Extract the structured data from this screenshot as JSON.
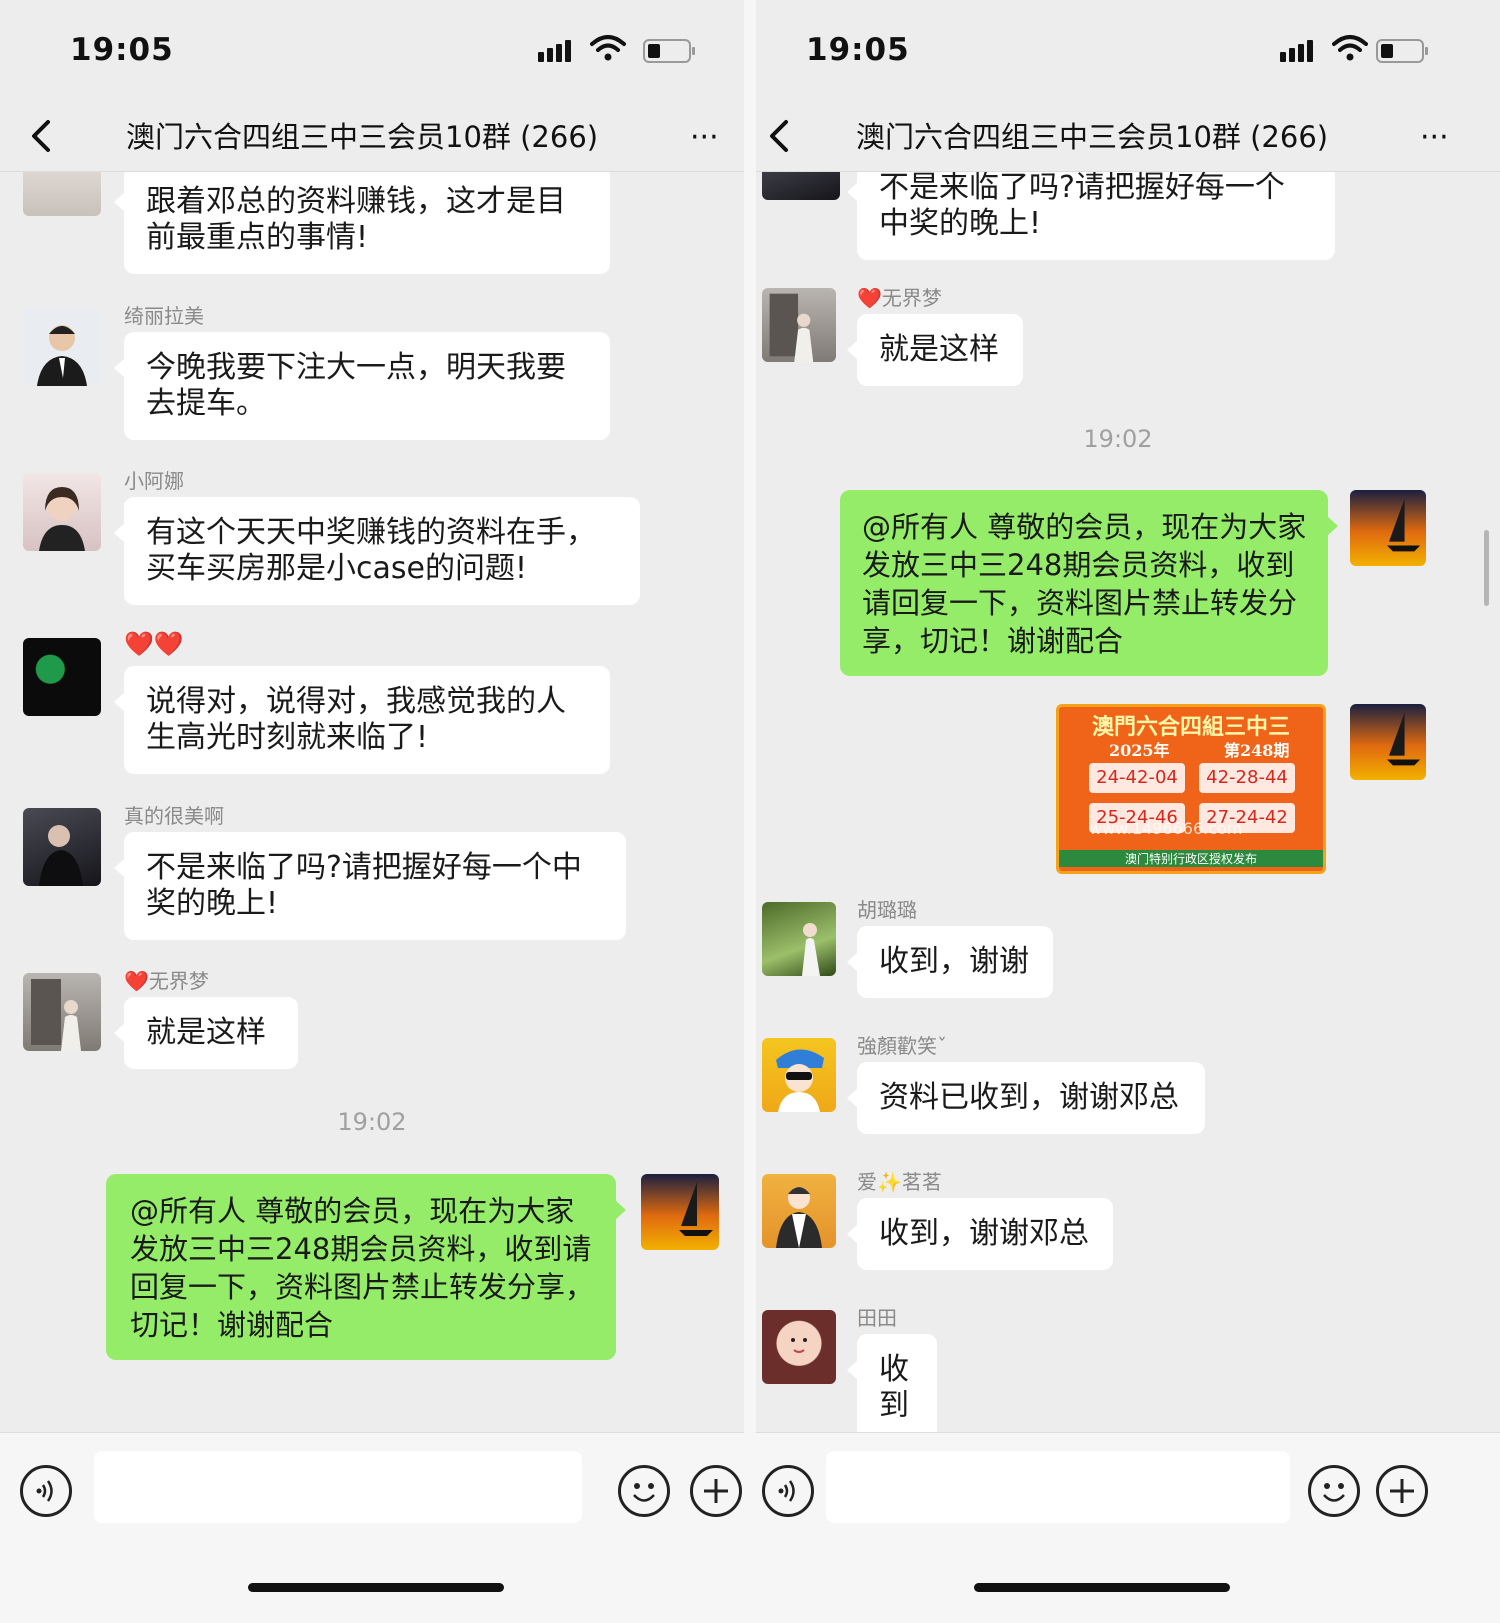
{
  "status": {
    "time": "19:05"
  },
  "header": {
    "title": "澳门六合四组三中三会员10群 (266)",
    "back_icon": "chevron-left-icon",
    "more_icon": "ellipsis-icon",
    "more_label": "···"
  },
  "left": {
    "messages": [
      {
        "sender": "",
        "text": "跟着邓总的资料赚钱，这才是目前最重点的事情!"
      },
      {
        "sender": "绮丽拉美",
        "text": "今晚我要下注大一点，明天我要去提车。"
      },
      {
        "sender": "小阿娜",
        "text": "有这个天天中奖赚钱的资料在手，买车买房那是小case的问题!"
      },
      {
        "sender": "❤️❤️",
        "text": "说得对，说得对，我感觉我的人生高光时刻就来临了!"
      },
      {
        "sender": "真的很美啊",
        "text": "不是来临了吗?请把握好每一个中奖的晚上!"
      },
      {
        "sender": "❤️无界梦",
        "text": "就是这样"
      }
    ],
    "timestamp": "19:02",
    "outgoing": "@所有人  尊敬的会员，现在为大家发放三中三248期会员资料，收到请回复一下，资料图片禁止转发分享，切记！谢谢配合"
  },
  "right": {
    "messages_top": [
      {
        "sender": "",
        "text": "不是来临了吗?请把握好每一个中奖的晚上!"
      },
      {
        "sender": "❤️无界梦",
        "text": "就是这样"
      }
    ],
    "timestamp": "19:02",
    "outgoing": "@所有人  尊敬的会员，现在为大家发放三中三248期会员资料，收到请回复一下，资料图片禁止转发分享，切记！谢谢配合",
    "poster": {
      "title": "澳門六合四組三中三",
      "year": "2025年",
      "issue": "第248期",
      "numbers": [
        "24-42-04",
        "42-28-44",
        "25-24-46",
        "27-24-42"
      ],
      "website": "www.1496666.com",
      "footer": "澳门特别行政区授权发布"
    },
    "messages_bottom": [
      {
        "sender": "胡璐璐",
        "text": "收到，谢谢"
      },
      {
        "sender": "強顏歡笑ˇ",
        "text": "资料已收到，谢谢邓总"
      },
      {
        "sender": "爱✨茗茗",
        "text": "收到，谢谢邓总"
      },
      {
        "sender": "田田",
        "text": "收到"
      }
    ]
  },
  "inputbar": {
    "voice_icon": "voice-icon",
    "emoji_icon": "emoji-icon",
    "plus_icon": "plus-icon"
  },
  "colors": {
    "background": "#ededed",
    "outgoing_bubble": "#95ec69",
    "incoming_bubble": "#ffffff"
  }
}
